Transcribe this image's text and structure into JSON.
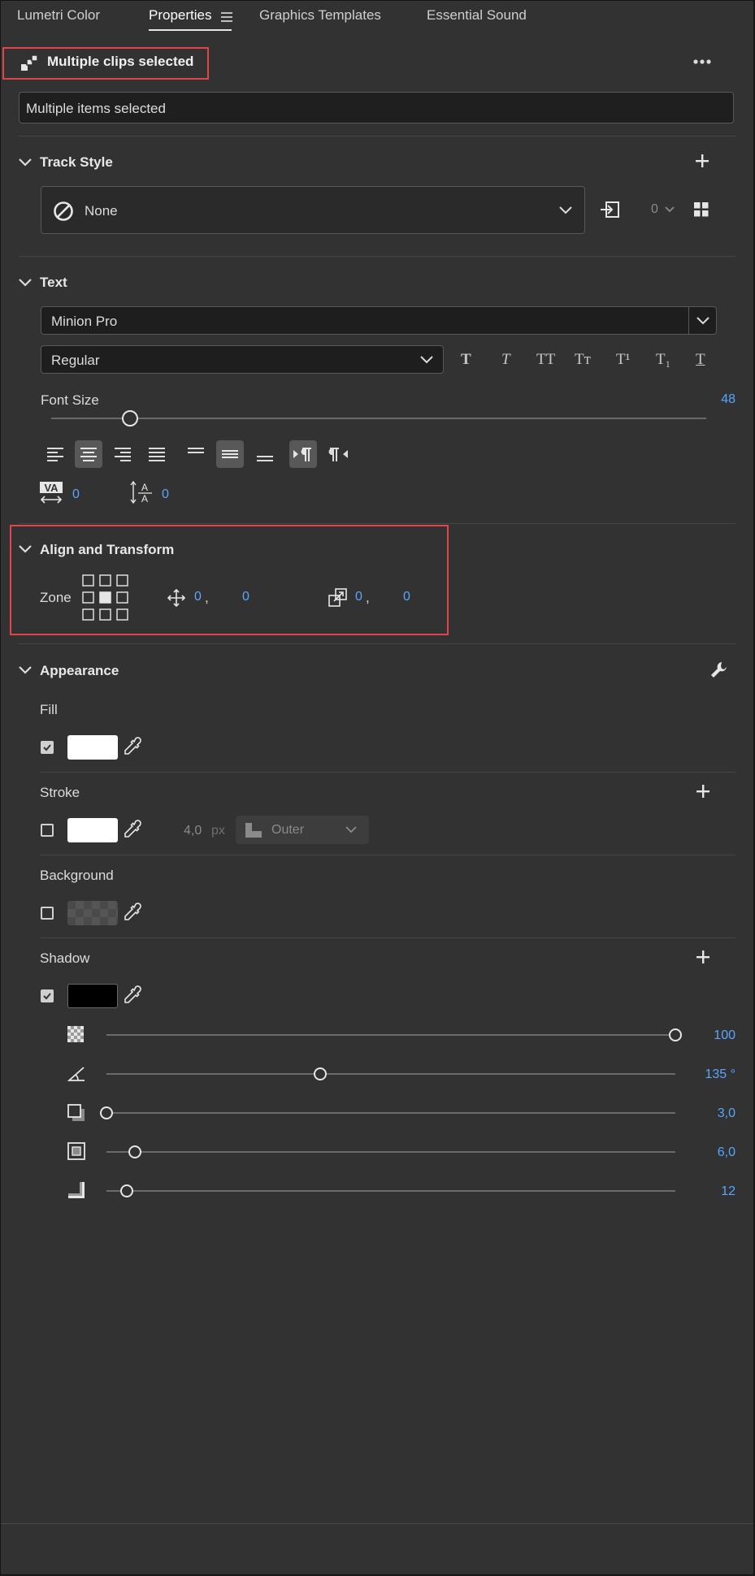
{
  "tabs": [
    {
      "label": "Lumetri Color",
      "active": false
    },
    {
      "label": "Properties",
      "active": true
    },
    {
      "label": "Graphics Templates",
      "active": false
    },
    {
      "label": "Essential Sound",
      "active": false
    }
  ],
  "header": {
    "title": "Multiple clips selected"
  },
  "selection_field": {
    "value": "Multiple items selected"
  },
  "track_style": {
    "title": "Track Style",
    "selected": "None",
    "count": "0"
  },
  "text": {
    "title": "Text",
    "font_family": "Minion Pro",
    "font_style": "Regular",
    "font_size_label": "Font Size",
    "font_size_value": "48",
    "font_size_fraction": 0.12,
    "kerning_value": "0",
    "leading_value": "0",
    "format_buttons": [
      "T",
      "T",
      "TT",
      "Tт",
      "T¹",
      "T₁",
      "T"
    ]
  },
  "align_transform": {
    "title": "Align and Transform",
    "zone_label": "Zone",
    "position_x": "0",
    "position_y": "0",
    "scale_x": "0",
    "scale_y": "0",
    "comma": ","
  },
  "appearance": {
    "title": "Appearance",
    "fill": {
      "label": "Fill",
      "checked": true,
      "color": "#ffffff"
    },
    "stroke": {
      "label": "Stroke",
      "checked": false,
      "color": "#ffffff",
      "width": "4,0",
      "unit": "px",
      "type": "Outer"
    },
    "background": {
      "label": "Background",
      "checked": false,
      "color": "#555555"
    },
    "shadow": {
      "label": "Shadow",
      "checked": true,
      "color": "#000000",
      "opacity": {
        "value": "100",
        "fraction": 1.0
      },
      "angle": {
        "value": "135 °",
        "fraction": 0.375
      },
      "distance": {
        "value": "3,0",
        "fraction": 0.0
      },
      "size": {
        "value": "6,0",
        "fraction": 0.05
      },
      "blur": {
        "value": "12",
        "fraction": 0.035
      }
    }
  },
  "colors": {
    "accent": "#57a6ff",
    "highlight": "#e0454b",
    "panel": "#323232"
  }
}
